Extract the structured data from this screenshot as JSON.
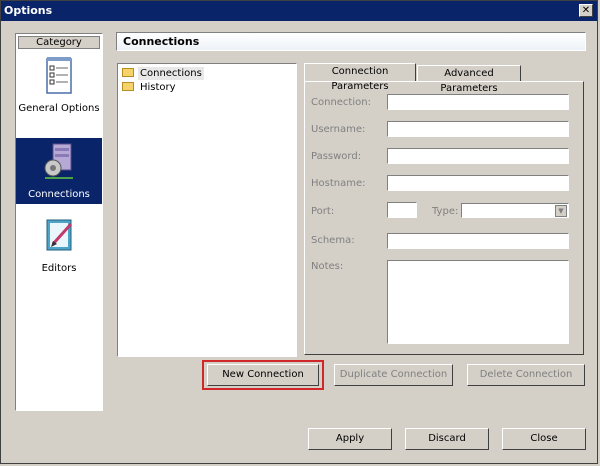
{
  "window": {
    "title": "Options",
    "close_glyph": "✕"
  },
  "category": {
    "header": "Category",
    "items": [
      {
        "label": "General Options",
        "icon": "checklist-icon",
        "selected": false
      },
      {
        "label": "Connections",
        "icon": "server-gear-icon",
        "selected": true
      },
      {
        "label": "Editors",
        "icon": "edit-document-icon",
        "selected": false
      }
    ]
  },
  "section": {
    "title": "Connections"
  },
  "tree": {
    "items": [
      {
        "label": "Connections",
        "selected": true
      },
      {
        "label": "History",
        "selected": false
      }
    ]
  },
  "tabs": [
    {
      "label": "Connection Parameters",
      "active": true
    },
    {
      "label": "Advanced Parameters",
      "active": false
    }
  ],
  "form": {
    "connection_label": "Connection:",
    "username_label": "Username:",
    "password_label": "Password:",
    "hostname_label": "Hostname:",
    "port_label": "Port:",
    "type_label": "Type:",
    "schema_label": "Schema:",
    "notes_label": "Notes:"
  },
  "buttons": {
    "new_connection": "New Connection",
    "duplicate_connection": "Duplicate Connection",
    "delete_connection": "Delete Connection",
    "apply": "Apply",
    "discard": "Discard",
    "close": "Close"
  },
  "colors": {
    "highlight": "#d0272a",
    "selection": "#0a246a"
  }
}
